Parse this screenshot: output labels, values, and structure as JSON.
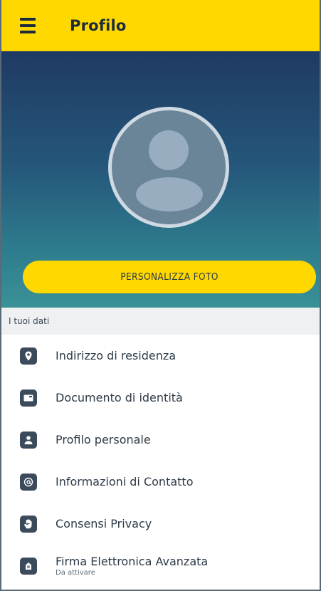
{
  "appbar": {
    "title": "Profilo",
    "menu_icon": "hamburger-menu-icon"
  },
  "hero": {
    "avatar_icon": "user-avatar-placeholder",
    "customize_button": "PERSONALIZZA FOTO"
  },
  "section": {
    "title": "I tuoi dati"
  },
  "items": [
    {
      "label": "Indirizzo di residenza",
      "icon": "location-pin-icon"
    },
    {
      "label": "Documento di identità",
      "icon": "id-card-icon"
    },
    {
      "label": "Profilo personale",
      "icon": "person-icon"
    },
    {
      "label": "Informazioni di Contatto",
      "icon": "at-sign-icon"
    },
    {
      "label": "Consensi Privacy",
      "icon": "hand-icon"
    },
    {
      "label": "Firma Elettronica Avanzata",
      "sublabel": "Da attivare",
      "icon": "signature-icon"
    }
  ],
  "colors": {
    "accent": "#ffd800",
    "hero_top": "#1f3a63",
    "hero_bottom": "#3a9196",
    "icon_bg": "#3c4b5b"
  }
}
